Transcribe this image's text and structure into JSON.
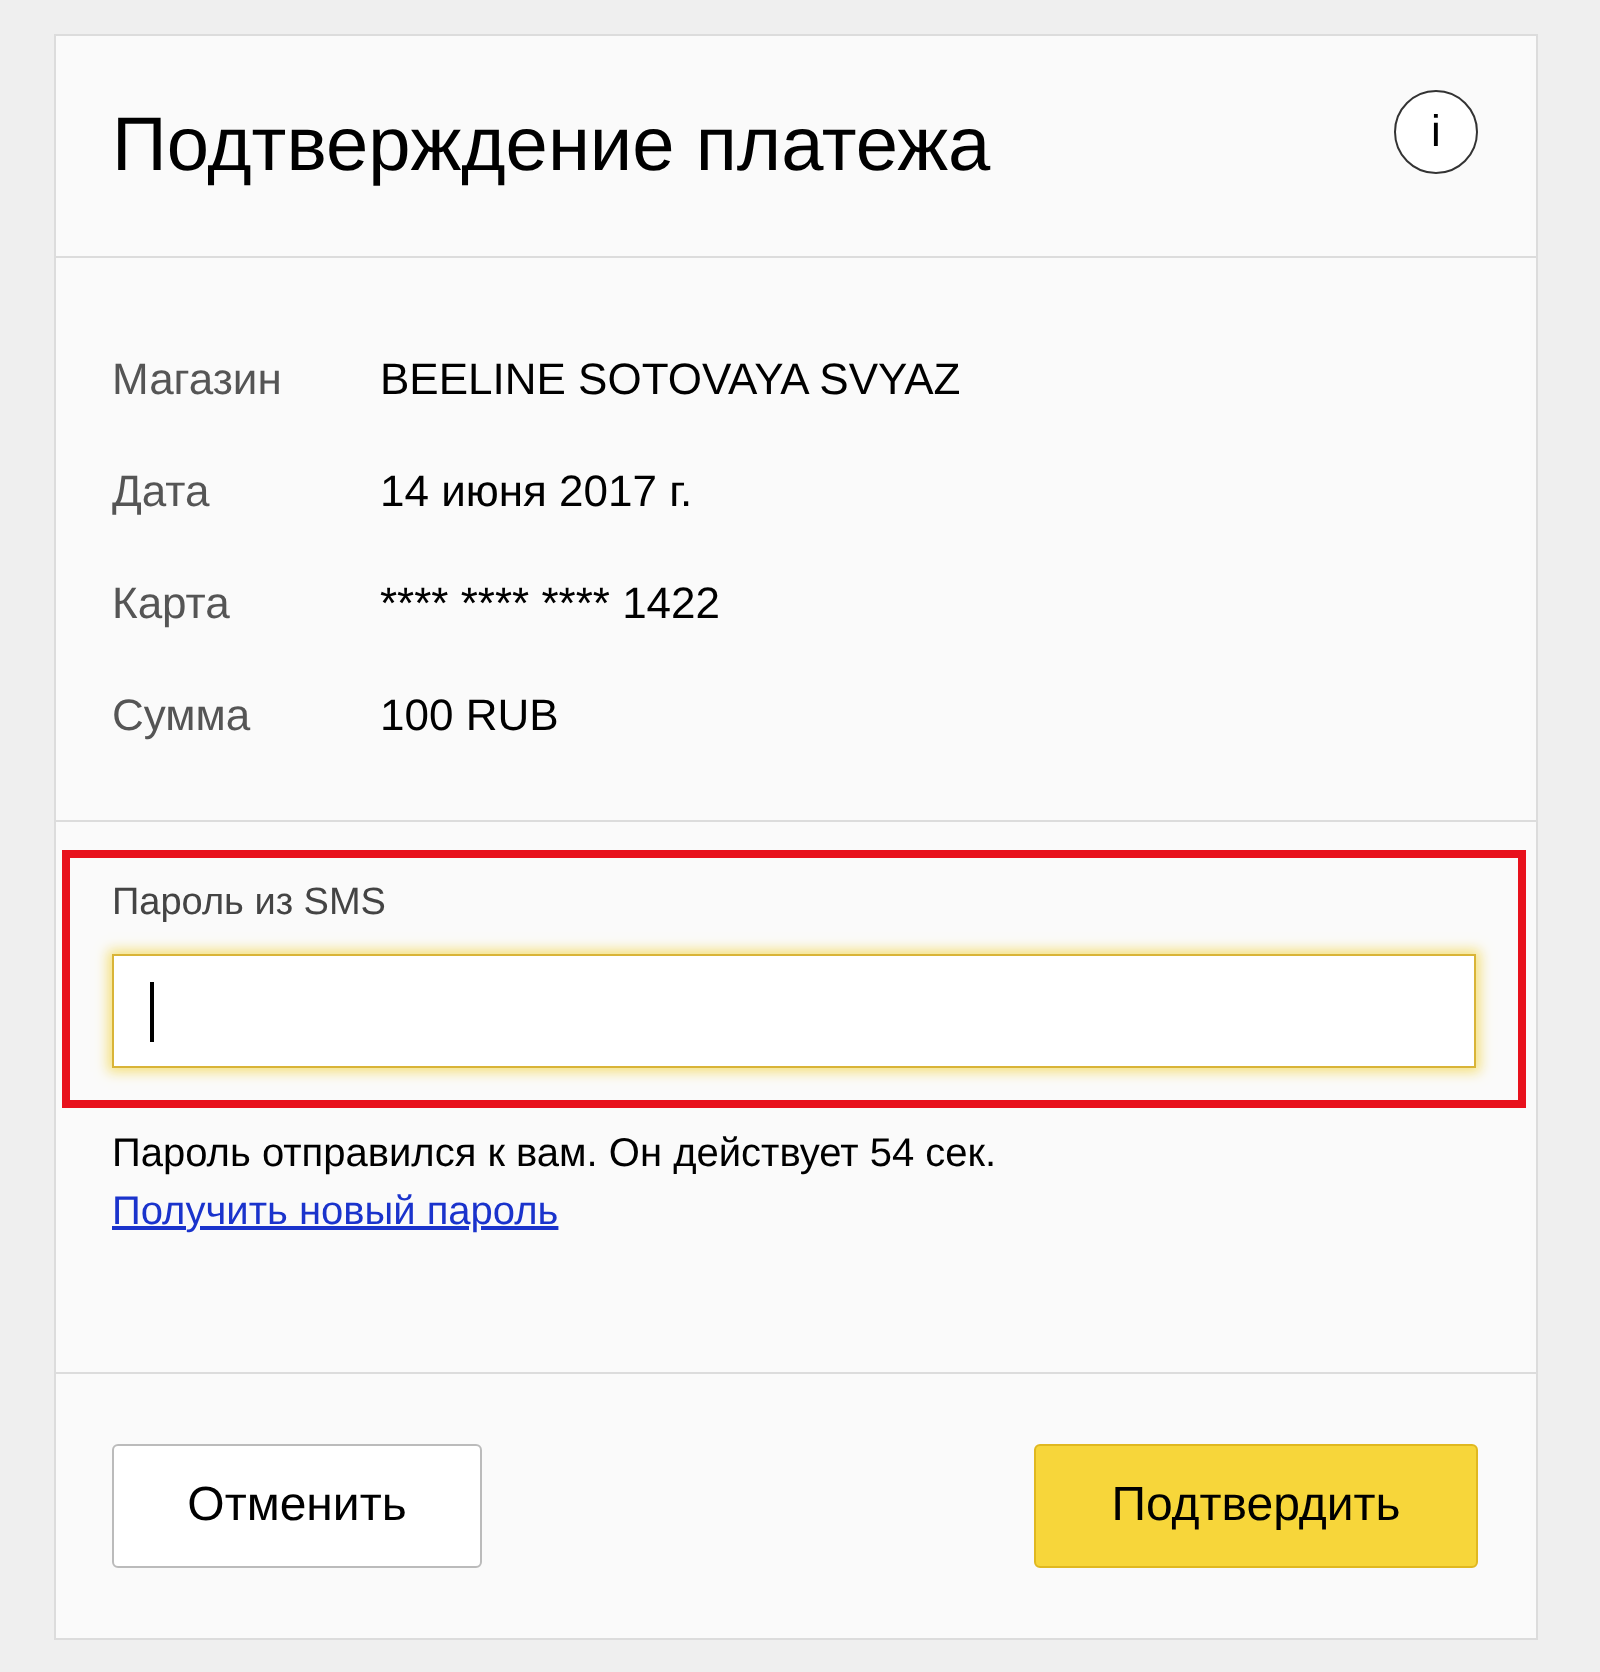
{
  "dialog": {
    "title": "Подтверждение платежа",
    "info_icon": "i"
  },
  "details": [
    {
      "label": "Магазин",
      "value": "BEELINE SOTOVAYA SVYAZ"
    },
    {
      "label": "Дата",
      "value": "14 июня 2017 г."
    },
    {
      "label": "Карта",
      "value": "**** **** **** 1422"
    },
    {
      "label": "Сумма",
      "value": "100 RUB"
    }
  ],
  "sms": {
    "highlighted": true,
    "label": "Пароль из SMS",
    "focused": true
  },
  "message": "Пароль отправился к вам. Он действует 54 сек.",
  "new_password_link": "Получить новый пароль",
  "buttons": [
    {
      "kind": "secondary",
      "label": "Отменить"
    },
    {
      "kind": "primary",
      "label": "Подтвердить"
    }
  ]
}
